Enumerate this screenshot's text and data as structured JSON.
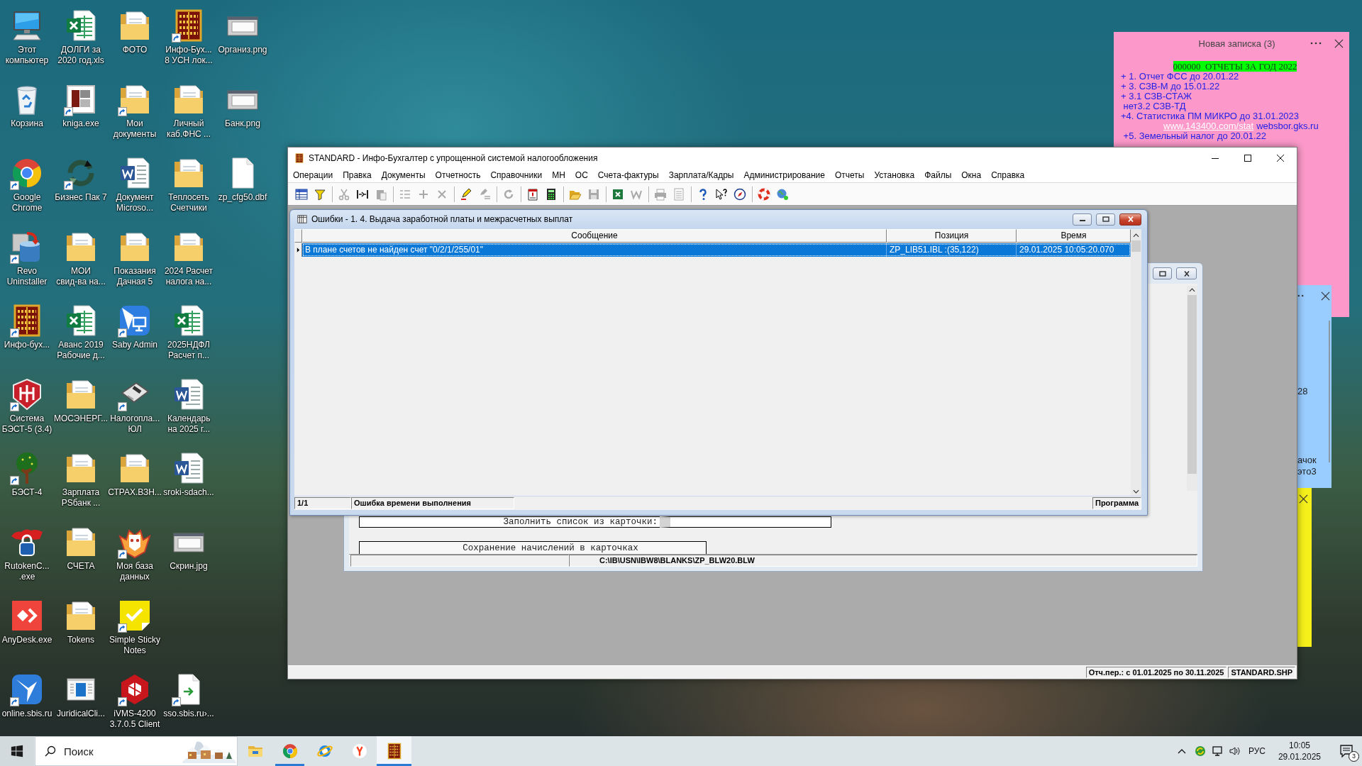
{
  "desktop": {
    "icon_rows": [
      [
        {
          "label": "Этот\nкомпьютер",
          "kind": "computer",
          "shortcut": false
        },
        {
          "label": "ДОЛГИ за\n2020 год.xls",
          "kind": "excel",
          "shortcut": false
        },
        {
          "label": "ФОТО",
          "kind": "folder",
          "shortcut": false
        },
        {
          "label": "Инфо-Бух...\n8 УСН лок...",
          "kind": "abacus",
          "shortcut": true
        },
        {
          "label": "Организ.png",
          "kind": "image",
          "shortcut": false
        }
      ],
      [
        {
          "label": "Корзина",
          "kind": "recycle",
          "shortcut": false
        },
        {
          "label": "kniga.exe",
          "kind": "blocks",
          "shortcut": true
        },
        {
          "label": "Мои\nдокументы",
          "kind": "folder",
          "shortcut": true
        },
        {
          "label": "Личный\nкаб.ФНС ...",
          "kind": "folder",
          "shortcut": false
        },
        {
          "label": "Банк.png",
          "kind": "image",
          "shortcut": false
        }
      ],
      [
        {
          "label": "Google\nChrome",
          "kind": "chrome",
          "shortcut": true
        },
        {
          "label": "Бизнес Пак 7",
          "kind": "arrows",
          "shortcut": true
        },
        {
          "label": "Документ\nMicroso...",
          "kind": "word",
          "shortcut": false
        },
        {
          "label": "Теплосеть\nСчетчики",
          "kind": "folder",
          "shortcut": false
        },
        {
          "label": "zp_cfg50.dbf",
          "kind": "file",
          "shortcut": false
        }
      ],
      [
        {
          "label": "Revo\nUninstaller",
          "kind": "revo",
          "shortcut": true
        },
        {
          "label": "МОИ\nсвид-ва на...",
          "kind": "folder",
          "shortcut": false
        },
        {
          "label": "Показания\nДачная 5",
          "kind": "folder",
          "shortcut": false
        },
        {
          "label": "2024 Расчет\nналога на...",
          "kind": "folder",
          "shortcut": false
        }
      ],
      [
        {
          "label": "Инфо-бух...",
          "kind": "abacus",
          "shortcut": true
        },
        {
          "label": "Аванс 2019\nРабочие д...",
          "kind": "excel",
          "shortcut": false
        },
        {
          "label": "Saby Admin",
          "kind": "saby",
          "shortcut": true
        },
        {
          "label": "2025НДФЛ\nРасчет п...",
          "kind": "excel",
          "shortcut": false
        }
      ],
      [
        {
          "label": "Система\nБЭСТ-5 (3.4)",
          "kind": "best",
          "shortcut": true
        },
        {
          "label": "МОСЭНЕРГ...",
          "kind": "folder",
          "shortcut": false
        },
        {
          "label": "Налогопла...\nЮЛ",
          "kind": "floppy",
          "shortcut": true
        },
        {
          "label": "Календарь\nна 2025 г...",
          "kind": "word",
          "shortcut": false
        }
      ],
      [
        {
          "label": "БЭСТ-4",
          "kind": "tree",
          "shortcut": true
        },
        {
          "label": "Зарплата\nPSбанк ...",
          "kind": "folder",
          "shortcut": false
        },
        {
          "label": "СТРАХ.ВЗН...",
          "kind": "folder",
          "shortcut": false
        },
        {
          "label": "sroki-sdach...",
          "kind": "word",
          "shortcut": false
        }
      ],
      [
        {
          "label": "RutokenC...\n.exe",
          "kind": "rutoken",
          "shortcut": false
        },
        {
          "label": "СЧЕТА",
          "kind": "folder",
          "shortcut": false
        },
        {
          "label": "Моя база\nданных",
          "kind": "owl",
          "shortcut": true
        },
        {
          "label": "Скрин.jpg",
          "kind": "image",
          "shortcut": false
        }
      ],
      [
        {
          "label": "AnyDesk.exe",
          "kind": "anydesk",
          "shortcut": false
        },
        {
          "label": "Tokens",
          "kind": "folder",
          "shortcut": false
        },
        {
          "label": "Simple Sticky\nNotes",
          "kind": "sticky",
          "shortcut": true
        }
      ],
      [
        {
          "label": "online.sbis.ru",
          "kind": "sbis",
          "shortcut": true
        },
        {
          "label": "JuridicalCli...",
          "kind": "juridical",
          "shortcut": false
        },
        {
          "label": "iVMS-4200\n3.7.0.5 Client",
          "kind": "ivms",
          "shortcut": true
        },
        {
          "label": "sso.sbis.ru›...",
          "kind": "filearrow",
          "shortcut": true
        }
      ]
    ]
  },
  "sticky_notes": [
    {
      "kind": "open",
      "color": "#fc99ca",
      "title": "Новая записка (3)",
      "buttons": [
        {
          "kind": "more"
        },
        {
          "kind": "close"
        }
      ],
      "lines": [
        {
          "kind": "heading",
          "text": "000000  ОТЧЕТЫ ЗА ГОД 2022"
        },
        {
          "kind": "text",
          "text": "+ 1. Отчет ФСС до 20.01.22"
        },
        {
          "kind": "text",
          "text": "+ 3. СЗВ-М до 15.01.22"
        },
        {
          "kind": "text",
          "text": "+ 3.1 СЗВ-СТАЖ"
        },
        {
          "kind": "text",
          "text": " нет3.2 СЗВ-ТД"
        },
        {
          "kind": "text",
          "text": "+4. Статистика ПМ МИКРО до 31.01.2023"
        },
        {
          "kind": "links",
          "link": "www.143400.com/stat",
          "text": "websbor.gks.ru"
        },
        {
          "kind": "text",
          "text": " +5. Земельный налог до 20.01.22"
        }
      ]
    },
    {
      "kind": "edge",
      "color": "#99ccff",
      "buttons": [
        {
          "kind": "more"
        },
        {
          "kind": "close"
        }
      ],
      "fragments": [
        "28",
        "ачок",
        "это3"
      ]
    },
    {
      "kind": "edge",
      "color": "#f5ef1a",
      "buttons": [
        {
          "kind": "close"
        }
      ]
    }
  ],
  "app_window": {
    "title": "STANDARD - Инфо-Бухгалтер с упрощенной системой налогообложения",
    "menu": [
      "Операции",
      "Правка",
      "Документы",
      "Отчетность",
      "Справочники",
      "МН",
      "ОС",
      "Счета-фактуры",
      "Зарплата/Кадры",
      "Администрирование",
      "Отчеты",
      "Установка",
      "Файлы",
      "Окна",
      "Справка"
    ],
    "toolbar": [
      [
        {
          "kind": "table",
          "disabled": false
        },
        {
          "kind": "filter",
          "disabled": false
        }
      ],
      [
        {
          "kind": "cut",
          "disabled": true
        },
        {
          "kind": "insert",
          "disabled": false
        },
        {
          "kind": "paste",
          "disabled": true
        }
      ],
      [
        {
          "kind": "numbering",
          "disabled": true
        },
        {
          "kind": "add",
          "disabled": true
        },
        {
          "kind": "delete",
          "disabled": true
        }
      ],
      [
        {
          "kind": "marker",
          "disabled": false
        },
        {
          "kind": "compare",
          "disabled": true
        }
      ],
      [
        {
          "kind": "refresh",
          "disabled": true
        }
      ],
      [
        {
          "kind": "export",
          "disabled": false
        },
        {
          "kind": "calculator",
          "disabled": false
        }
      ],
      [
        {
          "kind": "open",
          "disabled": false
        },
        {
          "kind": "save",
          "disabled": true
        }
      ],
      [
        {
          "kind": "excel",
          "disabled": false
        },
        {
          "kind": "word",
          "disabled": true
        }
      ],
      [
        {
          "kind": "print",
          "disabled": true
        },
        {
          "kind": "preview",
          "disabled": true
        }
      ],
      [
        {
          "kind": "help",
          "disabled": false
        },
        {
          "kind": "whatsthis",
          "disabled": false
        },
        {
          "kind": "compass",
          "disabled": false
        }
      ],
      [
        {
          "kind": "support",
          "disabled": false
        },
        {
          "kind": "web",
          "disabled": false
        }
      ]
    ],
    "error_window": {
      "title": "Ошибки - 1. 4. Выдача заработной платы и межрасчетных выплат",
      "columns": [
        "Сообщение",
        "Позиция",
        "Время"
      ],
      "rows": [
        {
          "selected": true,
          "cells": [
            "В плане счетов не найден счет \"0/2/1/255/01\"",
            "ZP_LIB51.IBL :(35,122)",
            "29.01.2025 10:05:20.070"
          ]
        }
      ],
      "status": {
        "counter": "1/1",
        "message": "Ошибка времени выполнения",
        "source": "Программа"
      }
    },
    "form_window": {
      "fields": [
        {
          "kind": "prompt",
          "label": "Заполнить список из карточки:"
        },
        {
          "kind": "action",
          "label": "Сохранение начислений в карточках"
        }
      ],
      "path": "C:\\IB\\USN\\IBW8\\BLANKS\\ZP_BLW20.BLW"
    },
    "status_bar": [
      "Отч.пер.: с 01.01.2025 по 30.11.2025",
      "STANDARD.SHP"
    ]
  },
  "taskbar": {
    "search": {
      "placeholder": "Поиск"
    },
    "apps": [
      {
        "kind": "explorer",
        "running": false,
        "active": false
      },
      {
        "kind": "chrome",
        "running": true,
        "active": false
      },
      {
        "kind": "ie",
        "running": false,
        "active": false
      },
      {
        "kind": "yandex",
        "running": false,
        "active": false
      },
      {
        "kind": "abacus",
        "running": true,
        "active": true
      }
    ],
    "tray": {
      "language": "РУС",
      "time": "10:05",
      "date": "29.01.2025",
      "notifications": "3"
    }
  }
}
